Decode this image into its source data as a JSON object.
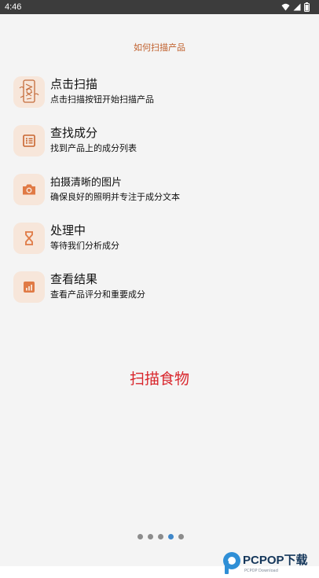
{
  "status_bar": {
    "time": "4:46",
    "icons": [
      "wifi-icon",
      "signal-icon",
      "battery-icon"
    ]
  },
  "page": {
    "title": "如何扫描产品"
  },
  "steps": [
    {
      "icon": "scan-illustration-icon",
      "title": "点击扫描",
      "desc": "点击扫描按钮开始扫描产品"
    },
    {
      "icon": "list-icon",
      "title": "查找成分",
      "desc": "找到产品上的成分列表"
    },
    {
      "icon": "camera-icon",
      "title": "拍摄清晰的图片",
      "desc": "确保良好的照明并专注于成分文本"
    },
    {
      "icon": "hourglass-icon",
      "title": "处理中",
      "desc": "等待我们分析成分"
    },
    {
      "icon": "chart-icon",
      "title": "查看结果",
      "desc": "查看产品评分和重要成分"
    }
  ],
  "scan_button": {
    "label": "扫描食物"
  },
  "pager": {
    "total": 5,
    "active_index": 3
  },
  "watermark": {
    "brand": "PCPOP下载",
    "sub": "PCPOP Download"
  },
  "colors": {
    "status_bar_bg": "#3c3c3c",
    "panel_bg": "#f4f4f4",
    "accent_orange": "#c0602d",
    "icon_tile_bg": "#f7e6da",
    "scan_red": "#d9262c",
    "pager_active": "#3f87c9",
    "pager_inactive": "#8c8c8c"
  }
}
